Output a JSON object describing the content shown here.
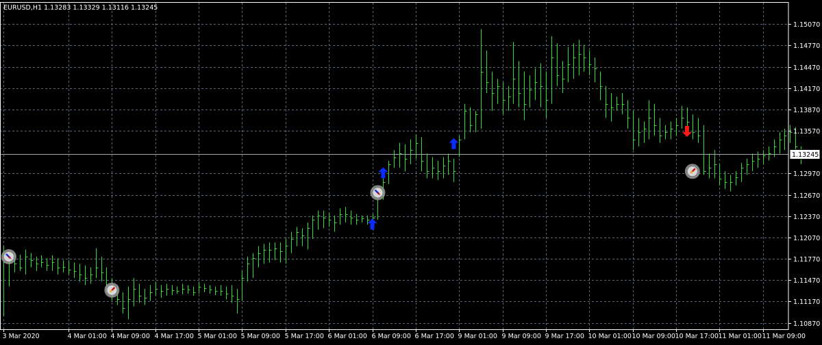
{
  "chart_data": {
    "type": "bar",
    "header": "EURUSD,H1  1.13283 1.13329 1.13116 1.13245",
    "ylim": [
      1.1078,
      1.1537
    ],
    "grid": true,
    "current_price_label": "1.13245",
    "current_price": 1.13245,
    "y_ticks": [
      {
        "label": "1.15070",
        "value": 1.1507
      },
      {
        "label": "1.14770",
        "value": 1.1477
      },
      {
        "label": "1.14470",
        "value": 1.1447
      },
      {
        "label": "1.14170",
        "value": 1.1417
      },
      {
        "label": "1.13870",
        "value": 1.1387
      },
      {
        "label": "1.13570",
        "value": 1.1357
      },
      {
        "label": "1.12970",
        "value": 1.1297
      },
      {
        "label": "1.12670",
        "value": 1.1267
      },
      {
        "label": "1.12370",
        "value": 1.1237
      },
      {
        "label": "1.12070",
        "value": 1.1207
      },
      {
        "label": "1.11770",
        "value": 1.1177
      },
      {
        "label": "1.11470",
        "value": 1.1147
      },
      {
        "label": "1.11170",
        "value": 1.1117
      },
      {
        "label": "1.10870",
        "value": 1.1087
      }
    ],
    "x_ticks": [
      {
        "label": "3 Mar 2020",
        "bar": 0
      },
      {
        "label": "4 Mar 01:00",
        "bar": 12
      },
      {
        "label": "4 Mar 09:00",
        "bar": 20
      },
      {
        "label": "4 Mar 17:00",
        "bar": 28
      },
      {
        "label": "5 Mar 01:00",
        "bar": 36
      },
      {
        "label": "5 Mar 09:00",
        "bar": 44
      },
      {
        "label": "5 Mar 17:00",
        "bar": 52
      },
      {
        "label": "6 Mar 01:00",
        "bar": 60
      },
      {
        "label": "6 Mar 09:00",
        "bar": 68
      },
      {
        "label": "6 Mar 17:00",
        "bar": 76
      },
      {
        "label": "9 Mar 01:00",
        "bar": 84
      },
      {
        "label": "9 Mar 09:00",
        "bar": 92
      },
      {
        "label": "9 Mar 17:00",
        "bar": 100
      },
      {
        "label": "10 Mar 01:00",
        "bar": 108
      },
      {
        "label": "10 Mar 09:00",
        "bar": 116
      },
      {
        "label": "10 Mar 17:00",
        "bar": 124
      },
      {
        "label": "11 Mar 01:00",
        "bar": 132
      },
      {
        "label": "11 Mar 09:00",
        "bar": 140
      }
    ],
    "bars": [
      {
        "h": 1.1195,
        "l": 1.1097,
        "c": 1.1172
      },
      {
        "h": 1.1178,
        "l": 1.1138,
        "c": 1.1172
      },
      {
        "h": 1.1185,
        "l": 1.1158,
        "c": 1.117
      },
      {
        "h": 1.1183,
        "l": 1.116,
        "c": 1.1165
      },
      {
        "h": 1.119,
        "l": 1.1155,
        "c": 1.118
      },
      {
        "h": 1.1185,
        "l": 1.1165,
        "c": 1.1175
      },
      {
        "h": 1.118,
        "l": 1.116,
        "c": 1.117
      },
      {
        "h": 1.1182,
        "l": 1.1165,
        "c": 1.1172
      },
      {
        "h": 1.1178,
        "l": 1.116,
        "c": 1.1168
      },
      {
        "h": 1.1182,
        "l": 1.116,
        "c": 1.1172
      },
      {
        "h": 1.1178,
        "l": 1.1155,
        "c": 1.1165
      },
      {
        "h": 1.1175,
        "l": 1.1158,
        "c": 1.1166
      },
      {
        "h": 1.1175,
        "l": 1.1155,
        "c": 1.1162
      },
      {
        "h": 1.1172,
        "l": 1.115,
        "c": 1.116
      },
      {
        "h": 1.117,
        "l": 1.1145,
        "c": 1.1155
      },
      {
        "h": 1.1168,
        "l": 1.114,
        "c": 1.115
      },
      {
        "h": 1.1165,
        "l": 1.1142,
        "c": 1.1155
      },
      {
        "h": 1.1192,
        "l": 1.115,
        "c": 1.1165
      },
      {
        "h": 1.118,
        "l": 1.1145,
        "c": 1.1158
      },
      {
        "h": 1.1165,
        "l": 1.113,
        "c": 1.114
      },
      {
        "h": 1.115,
        "l": 1.1118,
        "c": 1.1125
      },
      {
        "h": 1.114,
        "l": 1.1112,
        "c": 1.112
      },
      {
        "h": 1.113,
        "l": 1.11,
        "c": 1.1108
      },
      {
        "h": 1.1138,
        "l": 1.1092,
        "c": 1.112
      },
      {
        "h": 1.115,
        "l": 1.111,
        "c": 1.1135
      },
      {
        "h": 1.1142,
        "l": 1.1115,
        "c": 1.1125
      },
      {
        "h": 1.1135,
        "l": 1.1112,
        "c": 1.1122
      },
      {
        "h": 1.114,
        "l": 1.1118,
        "c": 1.113
      },
      {
        "h": 1.1145,
        "l": 1.1125,
        "c": 1.1135
      },
      {
        "h": 1.114,
        "l": 1.1122,
        "c": 1.1132
      },
      {
        "h": 1.1142,
        "l": 1.1125,
        "c": 1.1135
      },
      {
        "h": 1.114,
        "l": 1.1126,
        "c": 1.1133
      },
      {
        "h": 1.1138,
        "l": 1.1128,
        "c": 1.1132
      },
      {
        "h": 1.1142,
        "l": 1.1127,
        "c": 1.1135
      },
      {
        "h": 1.114,
        "l": 1.1128,
        "c": 1.1134
      },
      {
        "h": 1.1138,
        "l": 1.1125,
        "c": 1.113
      },
      {
        "h": 1.1145,
        "l": 1.1128,
        "c": 1.1138
      },
      {
        "h": 1.1142,
        "l": 1.113,
        "c": 1.1136
      },
      {
        "h": 1.114,
        "l": 1.1128,
        "c": 1.1134
      },
      {
        "h": 1.1138,
        "l": 1.1126,
        "c": 1.1132
      },
      {
        "h": 1.114,
        "l": 1.1125,
        "c": 1.1132
      },
      {
        "h": 1.1138,
        "l": 1.112,
        "c": 1.1128
      },
      {
        "h": 1.114,
        "l": 1.1115,
        "c": 1.1125
      },
      {
        "h": 1.1135,
        "l": 1.11,
        "c": 1.112
      },
      {
        "h": 1.116,
        "l": 1.1118,
        "c": 1.115
      },
      {
        "h": 1.118,
        "l": 1.1145,
        "c": 1.117
      },
      {
        "h": 1.1185,
        "l": 1.115,
        "c": 1.1178
      },
      {
        "h": 1.1195,
        "l": 1.1165,
        "c": 1.1185
      },
      {
        "h": 1.1198,
        "l": 1.117,
        "c": 1.119
      },
      {
        "h": 1.12,
        "l": 1.1172,
        "c": 1.119
      },
      {
        "h": 1.12,
        "l": 1.1175,
        "c": 1.1192
      },
      {
        "h": 1.12,
        "l": 1.1172,
        "c": 1.1188
      },
      {
        "h": 1.1205,
        "l": 1.117,
        "c": 1.1195
      },
      {
        "h": 1.1215,
        "l": 1.1185,
        "c": 1.1205
      },
      {
        "h": 1.1222,
        "l": 1.1195,
        "c": 1.1215
      },
      {
        "h": 1.122,
        "l": 1.1195,
        "c": 1.121
      },
      {
        "h": 1.1228,
        "l": 1.119,
        "c": 1.122
      },
      {
        "h": 1.1238,
        "l": 1.1205,
        "c": 1.1232
      },
      {
        "h": 1.1245,
        "l": 1.1218,
        "c": 1.1238
      },
      {
        "h": 1.1245,
        "l": 1.122,
        "c": 1.1235
      },
      {
        "h": 1.1242,
        "l": 1.1222,
        "c": 1.1232
      },
      {
        "h": 1.1238,
        "l": 1.1215,
        "c": 1.1228
      },
      {
        "h": 1.1248,
        "l": 1.1225,
        "c": 1.124
      },
      {
        "h": 1.125,
        "l": 1.1228,
        "c": 1.124
      },
      {
        "h": 1.1245,
        "l": 1.1225,
        "c": 1.1235
      },
      {
        "h": 1.124,
        "l": 1.1225,
        "c": 1.1232
      },
      {
        "h": 1.1238,
        "l": 1.1228,
        "c": 1.1234
      },
      {
        "h": 1.1238,
        "l": 1.1225,
        "c": 1.1232
      },
      {
        "h": 1.124,
        "l": 1.1225,
        "c": 1.1235
      },
      {
        "h": 1.1275,
        "l": 1.1232,
        "c": 1.127
      },
      {
        "h": 1.129,
        "l": 1.126,
        "c": 1.1285
      },
      {
        "h": 1.1315,
        "l": 1.1282,
        "c": 1.131
      },
      {
        "h": 1.133,
        "l": 1.1305,
        "c": 1.132
      },
      {
        "h": 1.134,
        "l": 1.1305,
        "c": 1.1325
      },
      {
        "h": 1.1338,
        "l": 1.13,
        "c": 1.1318
      },
      {
        "h": 1.1345,
        "l": 1.131,
        "c": 1.133
      },
      {
        "h": 1.1352,
        "l": 1.1318,
        "c": 1.134
      },
      {
        "h": 1.1348,
        "l": 1.13,
        "c": 1.1315
      },
      {
        "h": 1.1325,
        "l": 1.129,
        "c": 1.13
      },
      {
        "h": 1.132,
        "l": 1.129,
        "c": 1.1305
      },
      {
        "h": 1.1315,
        "l": 1.1288,
        "c": 1.13
      },
      {
        "h": 1.132,
        "l": 1.129,
        "c": 1.1308
      },
      {
        "h": 1.1325,
        "l": 1.1295,
        "c": 1.1315
      },
      {
        "h": 1.1318,
        "l": 1.1285,
        "c": 1.13
      },
      {
        "h": 1.135,
        "l": 1.132,
        "c": 1.1345
      },
      {
        "h": 1.1395,
        "l": 1.1345,
        "c": 1.1385
      },
      {
        "h": 1.139,
        "l": 1.1355,
        "c": 1.1365
      },
      {
        "h": 1.1385,
        "l": 1.1355,
        "c": 1.138
      },
      {
        "h": 1.15,
        "l": 1.136,
        "c": 1.144
      },
      {
        "h": 1.147,
        "l": 1.141,
        "c": 1.1425
      },
      {
        "h": 1.144,
        "l": 1.1385,
        "c": 1.141
      },
      {
        "h": 1.143,
        "l": 1.1395,
        "c": 1.142
      },
      {
        "h": 1.1425,
        "l": 1.138,
        "c": 1.14
      },
      {
        "h": 1.142,
        "l": 1.1385,
        "c": 1.1405
      },
      {
        "h": 1.1482,
        "l": 1.1395,
        "c": 1.143
      },
      {
        "h": 1.1455,
        "l": 1.139,
        "c": 1.141
      },
      {
        "h": 1.144,
        "l": 1.1372,
        "c": 1.1395
      },
      {
        "h": 1.1435,
        "l": 1.139,
        "c": 1.1415
      },
      {
        "h": 1.1445,
        "l": 1.14,
        "c": 1.1425
      },
      {
        "h": 1.1452,
        "l": 1.139,
        "c": 1.142
      },
      {
        "h": 1.144,
        "l": 1.1375,
        "c": 1.14
      },
      {
        "h": 1.149,
        "l": 1.1395,
        "c": 1.146
      },
      {
        "h": 1.148,
        "l": 1.142,
        "c": 1.1435
      },
      {
        "h": 1.1455,
        "l": 1.141,
        "c": 1.143
      },
      {
        "h": 1.1475,
        "l": 1.1425,
        "c": 1.145
      },
      {
        "h": 1.148,
        "l": 1.143,
        "c": 1.146
      },
      {
        "h": 1.1485,
        "l": 1.1435,
        "c": 1.1465
      },
      {
        "h": 1.1478,
        "l": 1.144,
        "c": 1.146
      },
      {
        "h": 1.147,
        "l": 1.1435,
        "c": 1.145
      },
      {
        "h": 1.146,
        "l": 1.1425,
        "c": 1.1445
      },
      {
        "h": 1.144,
        "l": 1.14,
        "c": 1.142
      },
      {
        "h": 1.142,
        "l": 1.1375,
        "c": 1.1395
      },
      {
        "h": 1.141,
        "l": 1.137,
        "c": 1.139
      },
      {
        "h": 1.1405,
        "l": 1.1385,
        "c": 1.1395
      },
      {
        "h": 1.141,
        "l": 1.138,
        "c": 1.1395
      },
      {
        "h": 1.14,
        "l": 1.136,
        "c": 1.1375
      },
      {
        "h": 1.1385,
        "l": 1.133,
        "c": 1.1345
      },
      {
        "h": 1.1375,
        "l": 1.1335,
        "c": 1.1355
      },
      {
        "h": 1.137,
        "l": 1.134,
        "c": 1.136
      },
      {
        "h": 1.14,
        "l": 1.1345,
        "c": 1.1375
      },
      {
        "h": 1.1395,
        "l": 1.135,
        "c": 1.1365
      },
      {
        "h": 1.1375,
        "l": 1.134,
        "c": 1.135
      },
      {
        "h": 1.1365,
        "l": 1.1345,
        "c": 1.1355
      },
      {
        "h": 1.137,
        "l": 1.1345,
        "c": 1.136
      },
      {
        "h": 1.1375,
        "l": 1.135,
        "c": 1.1365
      },
      {
        "h": 1.1392,
        "l": 1.136,
        "c": 1.1375
      },
      {
        "h": 1.139,
        "l": 1.1355,
        "c": 1.137
      },
      {
        "h": 1.138,
        "l": 1.1345,
        "c": 1.1355
      },
      {
        "h": 1.1375,
        "l": 1.134,
        "c": 1.135
      },
      {
        "h": 1.1365,
        "l": 1.1295,
        "c": 1.13
      },
      {
        "h": 1.1325,
        "l": 1.129,
        "c": 1.1305
      },
      {
        "h": 1.133,
        "l": 1.129,
        "c": 1.131
      },
      {
        "h": 1.131,
        "l": 1.128,
        "c": 1.129
      },
      {
        "h": 1.13,
        "l": 1.1275,
        "c": 1.1285
      },
      {
        "h": 1.1295,
        "l": 1.1272,
        "c": 1.1285
      },
      {
        "h": 1.13,
        "l": 1.128,
        "c": 1.1292
      },
      {
        "h": 1.1312,
        "l": 1.1285,
        "c": 1.1305
      },
      {
        "h": 1.1318,
        "l": 1.1295,
        "c": 1.131
      },
      {
        "h": 1.1325,
        "l": 1.13,
        "c": 1.1315
      },
      {
        "h": 1.1328,
        "l": 1.1305,
        "c": 1.1318
      },
      {
        "h": 1.133,
        "l": 1.131,
        "c": 1.1322
      },
      {
        "h": 1.1335,
        "l": 1.1315,
        "c": 1.1325
      },
      {
        "h": 1.1345,
        "l": 1.132,
        "c": 1.1335
      },
      {
        "h": 1.1355,
        "l": 1.1325,
        "c": 1.1345
      },
      {
        "h": 1.136,
        "l": 1.133,
        "c": 1.135
      },
      {
        "h": 1.1365,
        "l": 1.134,
        "c": 1.1355
      },
      {
        "h": 1.1362,
        "l": 1.1325,
        "c": 1.1335
      },
      {
        "h": 1.1335,
        "l": 1.131,
        "c": 1.1324
      }
    ],
    "up_arrows": [
      {
        "bar": 68,
        "price": 1.1225
      },
      {
        "bar": 70,
        "price": 1.1297
      },
      {
        "bar": 83,
        "price": 1.1338
      }
    ],
    "down_arrows": [
      {
        "bar": 126,
        "price": 1.1357
      }
    ],
    "buy_markers": [
      {
        "bar": 1,
        "price": 1.118
      },
      {
        "bar": 69,
        "price": 1.127
      }
    ],
    "sell_markers": [
      {
        "bar": 20,
        "price": 1.1133
      },
      {
        "bar": 127,
        "price": 1.13
      }
    ],
    "colors": {
      "background": "#000000",
      "grid": "#5a6a7a",
      "bars": "#33dd33",
      "axis": "#ffffff",
      "text": "#ffffff",
      "price_line": "#a0a8b0",
      "up_arrow": "#0a2cff",
      "down_arrow": "#ff1a1a",
      "marker_ring": "#9a9a9a"
    }
  }
}
